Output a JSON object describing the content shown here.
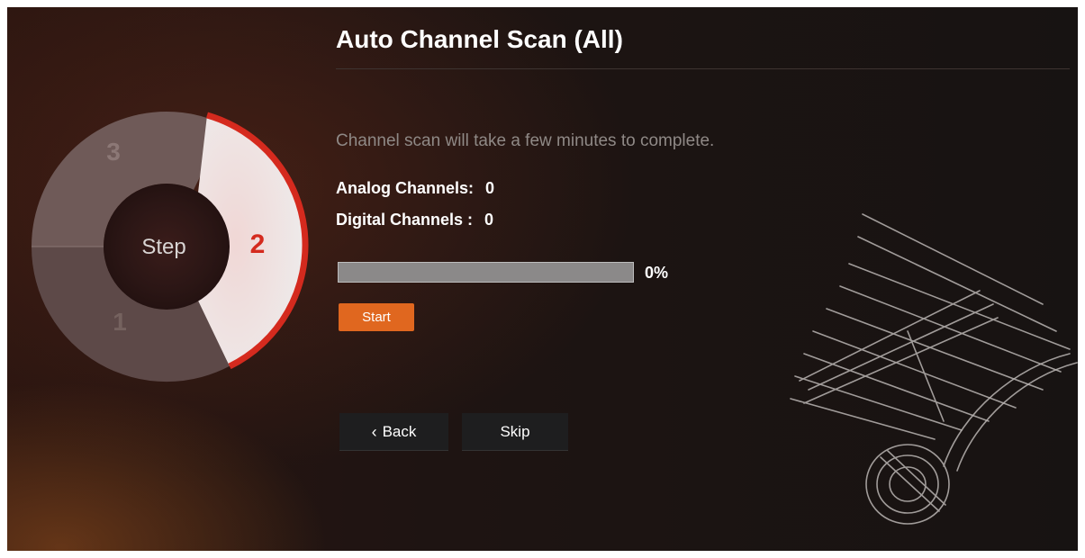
{
  "wizard": {
    "center_label": "Step",
    "steps": [
      {
        "number": "1",
        "active": false
      },
      {
        "number": "2",
        "active": true
      },
      {
        "number": "3",
        "active": false
      }
    ]
  },
  "header": {
    "title": "Auto Channel Scan (All)"
  },
  "main": {
    "description": "Channel scan will take a few minutes to complete.",
    "counts": {
      "analog_label": "Analog Channels:",
      "analog_value": "0",
      "digital_label": "Digital Channels :",
      "digital_value": "0"
    },
    "progress": {
      "percent": 0,
      "percent_text": "0%"
    },
    "start_label": "Start"
  },
  "footer": {
    "back_label": "Back",
    "back_icon": "chevron-left-icon",
    "skip_label": "Skip"
  },
  "colors": {
    "accent_orange": "#e0671f",
    "active_step_red": "#d42a1e"
  }
}
